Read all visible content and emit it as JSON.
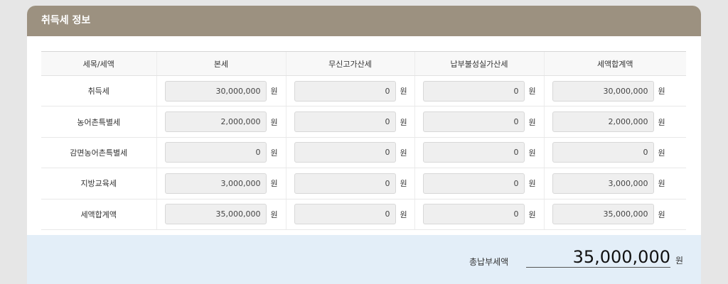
{
  "section_title": "취득세 정보",
  "table": {
    "headers": [
      "세목/세액",
      "본세",
      "무신고가산세",
      "납부불성실가산세",
      "세액합계액"
    ],
    "rows": [
      {
        "label": "취득세",
        "values": [
          "30,000,000",
          "0",
          "0",
          "30,000,000"
        ]
      },
      {
        "label": "농어촌특별세",
        "values": [
          "2,000,000",
          "0",
          "0",
          "2,000,000"
        ]
      },
      {
        "label": "감면농어촌특별세",
        "values": [
          "0",
          "0",
          "0",
          "0"
        ]
      },
      {
        "label": "지방교육세",
        "values": [
          "3,000,000",
          "0",
          "0",
          "3,000,000"
        ]
      },
      {
        "label": "세액합계액",
        "values": [
          "35,000,000",
          "0",
          "0",
          "35,000,000"
        ]
      }
    ],
    "unit": "원"
  },
  "total": {
    "label": "총납부세액",
    "value": "35,000,000",
    "unit": "원"
  },
  "colors": {
    "header_bg": "#9c9180",
    "footer_bg": "#e3eef8",
    "field_bg": "#efefef"
  }
}
